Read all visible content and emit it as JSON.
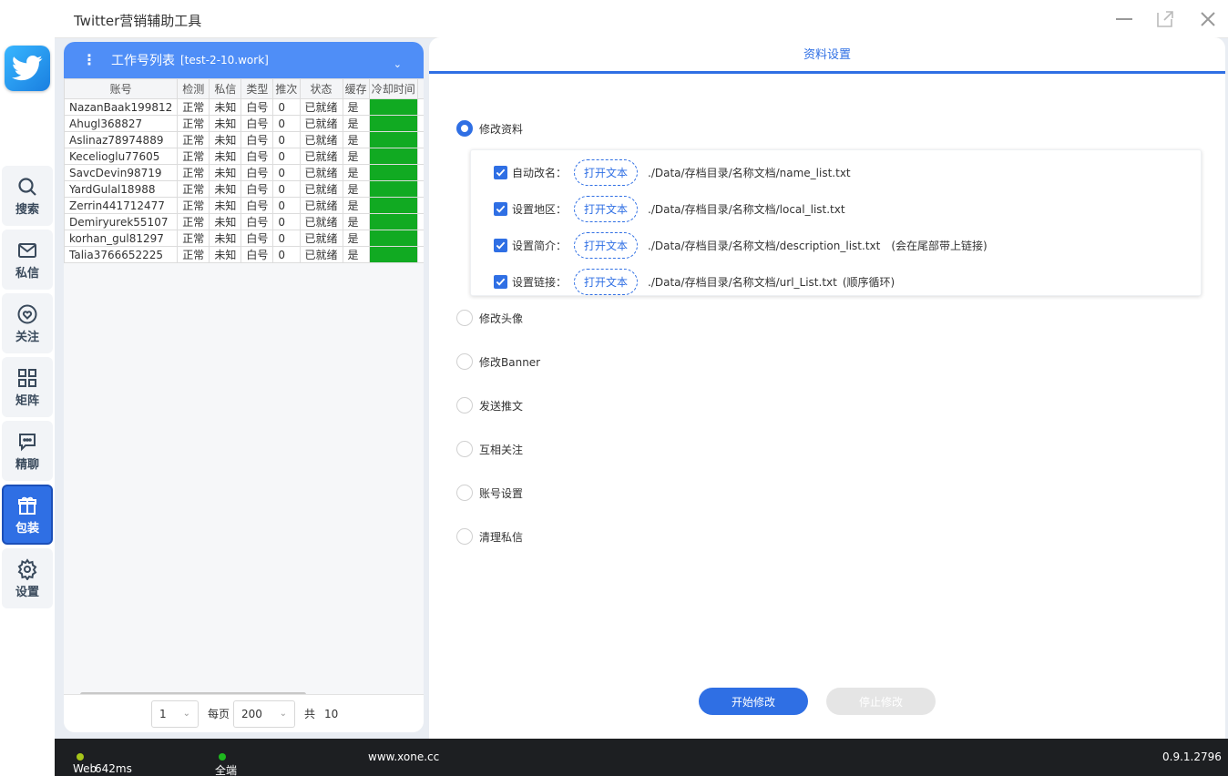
{
  "window": {
    "title": "Twitter营销辅助工具"
  },
  "nav": [
    {
      "label": "搜索",
      "icon": "search-icon"
    },
    {
      "label": "私信",
      "icon": "mail-icon"
    },
    {
      "label": "关注",
      "icon": "heart-icon"
    },
    {
      "label": "矩阵",
      "icon": "grid-icon"
    },
    {
      "label": "精聊",
      "icon": "chat-icon"
    },
    {
      "label": "包装",
      "icon": "gift-icon",
      "active": true
    },
    {
      "label": "设置",
      "icon": "gear-icon"
    }
  ],
  "account_panel": {
    "title": "工作号列表",
    "file": "[test-2-10.work]",
    "columns": [
      "账号",
      "检测",
      "私信",
      "类型",
      "推次",
      "状态",
      "缓存",
      "冷却时间"
    ],
    "rows": [
      {
        "account": "NazanBaak199812",
        "check": "正常",
        "dm": "未知",
        "type": "白号",
        "count": "0",
        "status": "已就绪",
        "cache": "是"
      },
      {
        "account": "Ahugl368827",
        "check": "正常",
        "dm": "未知",
        "type": "白号",
        "count": "0",
        "status": "已就绪",
        "cache": "是"
      },
      {
        "account": "Aslinaz78974889",
        "check": "正常",
        "dm": "未知",
        "type": "白号",
        "count": "0",
        "status": "已就绪",
        "cache": "是"
      },
      {
        "account": "Kecelioglu77605",
        "check": "正常",
        "dm": "未知",
        "type": "白号",
        "count": "0",
        "status": "已就绪",
        "cache": "是"
      },
      {
        "account": "SavcDevin98719",
        "check": "正常",
        "dm": "未知",
        "type": "白号",
        "count": "0",
        "status": "已就绪",
        "cache": "是"
      },
      {
        "account": "YardGulal18988",
        "check": "正常",
        "dm": "未知",
        "type": "白号",
        "count": "0",
        "status": "已就绪",
        "cache": "是"
      },
      {
        "account": "Zerrin441712477",
        "check": "正常",
        "dm": "未知",
        "type": "白号",
        "count": "0",
        "status": "已就绪",
        "cache": "是"
      },
      {
        "account": "Demiryurek55107",
        "check": "正常",
        "dm": "未知",
        "type": "白号",
        "count": "0",
        "status": "已就绪",
        "cache": "是"
      },
      {
        "account": "korhan_gul81297",
        "check": "正常",
        "dm": "未知",
        "type": "白号",
        "count": "0",
        "status": "已就绪",
        "cache": "是"
      },
      {
        "account": "Talia3766652225",
        "check": "正常",
        "dm": "未知",
        "type": "白号",
        "count": "0",
        "status": "已就绪",
        "cache": "是"
      }
    ],
    "pager": {
      "page": "1",
      "per_page_label": "每页",
      "per_page": "200",
      "total_label": "共",
      "total": "10"
    }
  },
  "settings_panel": {
    "tab": "资料设置",
    "options": [
      "修改资料",
      "修改头像",
      "修改Banner",
      "发送推文",
      "互相关注",
      "账号设置",
      "清理私信"
    ],
    "open_label": "打开文本",
    "sub_items": [
      {
        "label": "自动改名：",
        "path": "./Data/存档目录/名称文档/name_list.txt",
        "note": ""
      },
      {
        "label": "设置地区：",
        "path": "./Data/存档目录/名称文档/local_list.txt",
        "note": ""
      },
      {
        "label": "设置简介：",
        "path": "./Data/存档目录/名称文档/description_list.txt",
        "note": "(会在尾部带上链接)"
      },
      {
        "label": "设置链接：",
        "path": "./Data/存档目录/名称文档/url_List.txt",
        "note": "(顺序循环)"
      }
    ],
    "start_button": "开始修改",
    "stop_button": "停止修改"
  },
  "status_bar": {
    "web_port_label": "Web端口：",
    "latency": "642ms",
    "all_port_label": "全端口：",
    "site": "www.xone.cc",
    "version": "0.9.1.2796"
  },
  "colors": {
    "accent": "#2f6fe4",
    "cooldown": "#11aa22",
    "web_dot": "#a6c51a",
    "all_dot": "#1eb81e"
  }
}
